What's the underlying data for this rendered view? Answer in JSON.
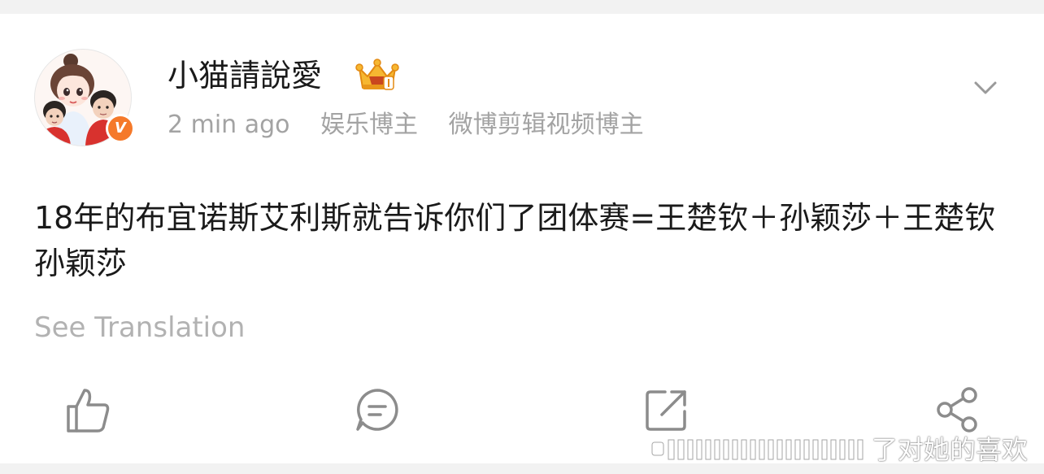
{
  "post": {
    "author": {
      "name": "小猫請說愛",
      "avatar_icon": "cartoon-avatar-icon",
      "verified_badge_letter": "V",
      "verified_color": "#f5792a",
      "crown_icon": "crown-icon"
    },
    "time": "2 min ago",
    "tags": [
      "娱乐博主",
      "微博剪辑视频博主"
    ],
    "text": "18年的布宜诺斯艾利斯就告诉你们了团体赛=王楚钦＋孙颖莎＋王楚钦孙颖莎",
    "see_translation": "See Translation",
    "menu_icon": "chevron-down-icon"
  },
  "actions": [
    {
      "name": "like",
      "icon": "thumbs-up-icon"
    },
    {
      "name": "comment",
      "icon": "comment-bubble-icon"
    },
    {
      "name": "repost",
      "icon": "repost-arrow-icon"
    },
    {
      "name": "share",
      "icon": "share-icon"
    }
  ],
  "watermark": {
    "text": "了对她的喜欢"
  },
  "colors": {
    "background": "#f2f2f2",
    "card": "#ffffff",
    "primary_text": "#1a1a1a",
    "secondary_text": "#a3a3a3",
    "icon": "#8c8c8c"
  }
}
